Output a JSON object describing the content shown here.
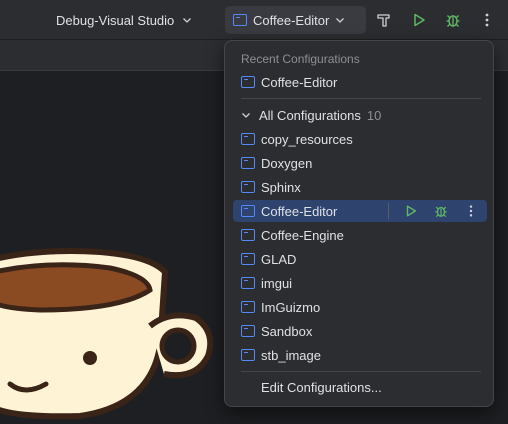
{
  "toolbar": {
    "solution_config": "Debug-Visual Studio",
    "run_config": "Coffee-Editor"
  },
  "popup": {
    "recent_header": "Recent Configurations",
    "recent_items": [
      "Coffee-Editor"
    ],
    "all_header": "All Configurations",
    "all_count": "10",
    "all_items": [
      "copy_resources",
      "Doxygen",
      "Sphinx",
      "Coffee-Editor",
      "Coffee-Engine",
      "GLAD",
      "imgui",
      "ImGuizmo",
      "Sandbox",
      "stb_image"
    ],
    "selected_item": "Coffee-Editor",
    "edit_label": "Edit Configurations..."
  },
  "colors": {
    "accent_blue": "#548af7",
    "run_green": "#5fb865",
    "selection": "#2e436e",
    "background": "#1e1f22",
    "panel": "#2b2d30"
  },
  "icons": [
    "chevron-down-icon",
    "config-icon",
    "build-hammer-icon",
    "run-icon",
    "debug-icon",
    "more-vertical-icon"
  ]
}
